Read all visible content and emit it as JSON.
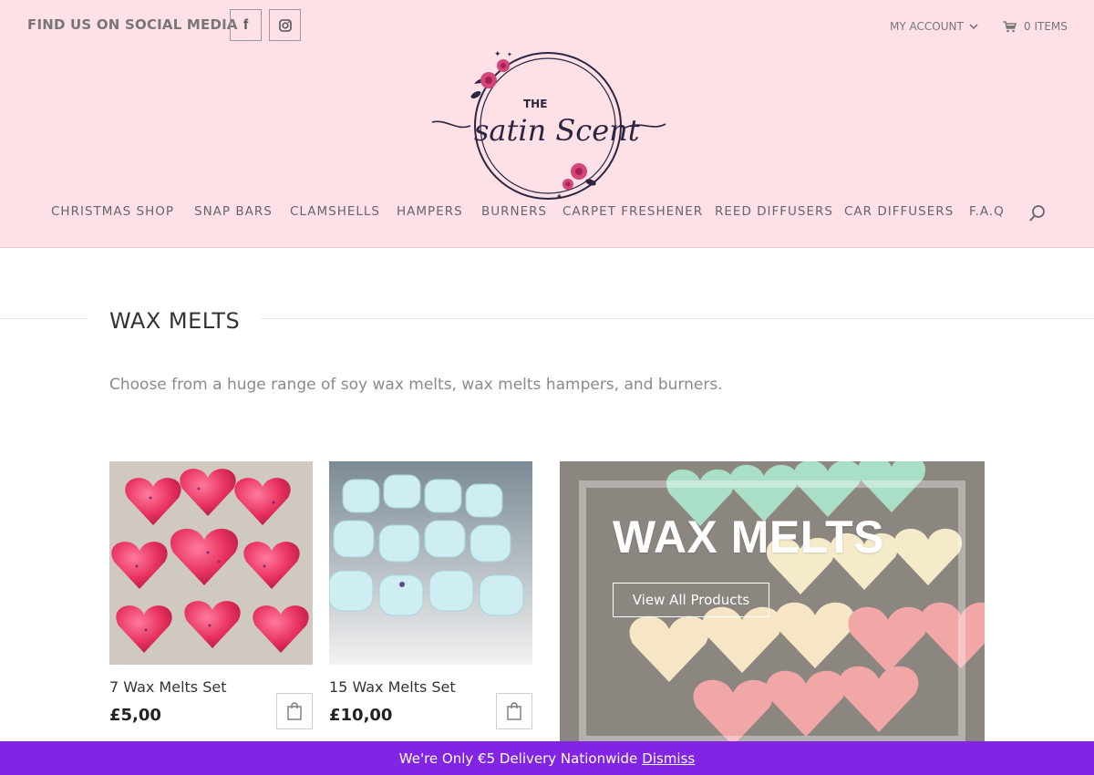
{
  "topbar": {
    "social_text": "FIND US ON SOCIAL MEDIA",
    "facebook_glyph": "f",
    "account_label": "MY ACCOUNT",
    "cart_label": "0 ITEMS"
  },
  "logo": {
    "line1": "THE",
    "line2": "satin Scent"
  },
  "nav": {
    "items": [
      {
        "label": "CHRISTMAS SHOP"
      },
      {
        "label": "SNAP BARS"
      },
      {
        "label": "CLAMSHELLS"
      },
      {
        "label": "HAMPERS"
      },
      {
        "label": "BURNERS"
      },
      {
        "label": "CARPET FRESHENER"
      },
      {
        "label": "REED DIFFUSERS"
      },
      {
        "label": "CAR DIFFUSERS"
      },
      {
        "label": "F.A.Q"
      }
    ]
  },
  "section": {
    "title": "WAX MELTS",
    "intro": "Choose from a huge range of soy wax melts, wax melts hampers, and burners."
  },
  "products": [
    {
      "name": "7 Wax Melts Set",
      "price": "£5,00"
    },
    {
      "name": "15 Wax Melts Set",
      "price": "£10,00"
    }
  ],
  "banner": {
    "title": "WAX MELTS",
    "button_label": "View All Products"
  },
  "notice": {
    "text": "We're Only €5 Delivery Nationwide",
    "dismiss": "Dismiss"
  },
  "colors": {
    "header_bg": "#fde1e7",
    "notice_bg": "#8224e3",
    "text": "#333333"
  }
}
